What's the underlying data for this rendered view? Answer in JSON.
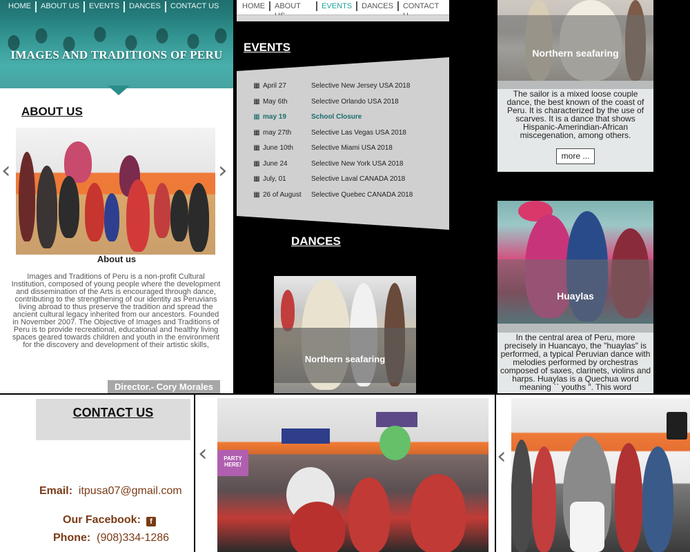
{
  "nav": {
    "items": [
      "HOME",
      "ABOUT US",
      "EVENTS",
      "DANCES",
      "CONTACT US"
    ],
    "items_truncated": [
      "HOME",
      "ABOUT US",
      "EVENTS",
      "DANCES",
      "CONTACT U"
    ],
    "active": "EVENTS"
  },
  "hero": {
    "title": "IMAGES AND TRADITIONS OF PERU"
  },
  "about": {
    "heading": "ABOUT US",
    "caption": "About us",
    "text": "Images and Traditions of Peru is a non-profit Cultural Institution, composed of young people where the development and dissemination of the Arts is encouraged through dance, contributing to the strengthening of our identity as Peruvians living abroad to thus preserve the tradition and spread the ancient cultural legacy inherited from our ancestors. Founded in November 2007. The Objective of Images and Traditions of Peru is to provide recreational, educational and healthy living spaces geared towards children and youth in the environment for the discovery and development of their artistic skills,",
    "director": "Director.- Cory Morales",
    "prev": "‹",
    "next": "›"
  },
  "events": {
    "heading": "EVENTS",
    "items": [
      {
        "date": "April 27",
        "event": "Selective New Jersey USA 2018",
        "highlight": false
      },
      {
        "date": "May 6th",
        "event": "Selective Orlando USA 2018",
        "highlight": false
      },
      {
        "date": "may 19",
        "event": "School Closure",
        "highlight": true
      },
      {
        "date": "may 27th",
        "event": "Selective Las Vegas USA 2018",
        "highlight": false
      },
      {
        "date": "June 10th",
        "event": "Selective Miami USA 2018",
        "highlight": false
      },
      {
        "date": "June 24",
        "event": "Selective New York USA 2018",
        "highlight": false
      },
      {
        "date": "July, 01",
        "event": "Selective Laval CANADA 2018",
        "highlight": false
      },
      {
        "date": "26 of August",
        "event": "Selective Quebec CANADA 2018",
        "highlight": false
      }
    ],
    "calendar_icon": "▦"
  },
  "dances": {
    "heading": "DANCES",
    "preview_caption": "Northern seafaring",
    "cards": [
      {
        "title": "Northern seafaring",
        "text": "The sailor is a mixed loose couple dance, the best known of the coast of Peru. It is characterized by the use of scarves. It is a dance that shows Hispanic-Amerindian-African miscegenation, among others.",
        "more": "more ..."
      },
      {
        "title": "Huaylas",
        "text": "In the central area of Peru, more precisely in Huancayo, the \"huaylas\" is performed, a typical Peruvian dance with melodies performed by orchestras composed of saxes, clarinets, violins and harps. Huaylas is a Quechua word meaning `` youths \". This word"
      }
    ]
  },
  "contact": {
    "heading": "CONTACT US",
    "email_label": "Email:",
    "email": "itpusa07@gmail.com",
    "facebook_label": "Our Facebook:",
    "facebook_icon": "f",
    "phone_label": "Phone:",
    "phone": "(908)334-1286"
  },
  "gallery": {
    "prev": "‹",
    "next": "‹",
    "sign_text": "PARTY HERE!"
  },
  "colors": {
    "teal": "#2a8d8a",
    "accent_brown": "#7a3b16",
    "highlight_teal": "#1b6e6c"
  }
}
